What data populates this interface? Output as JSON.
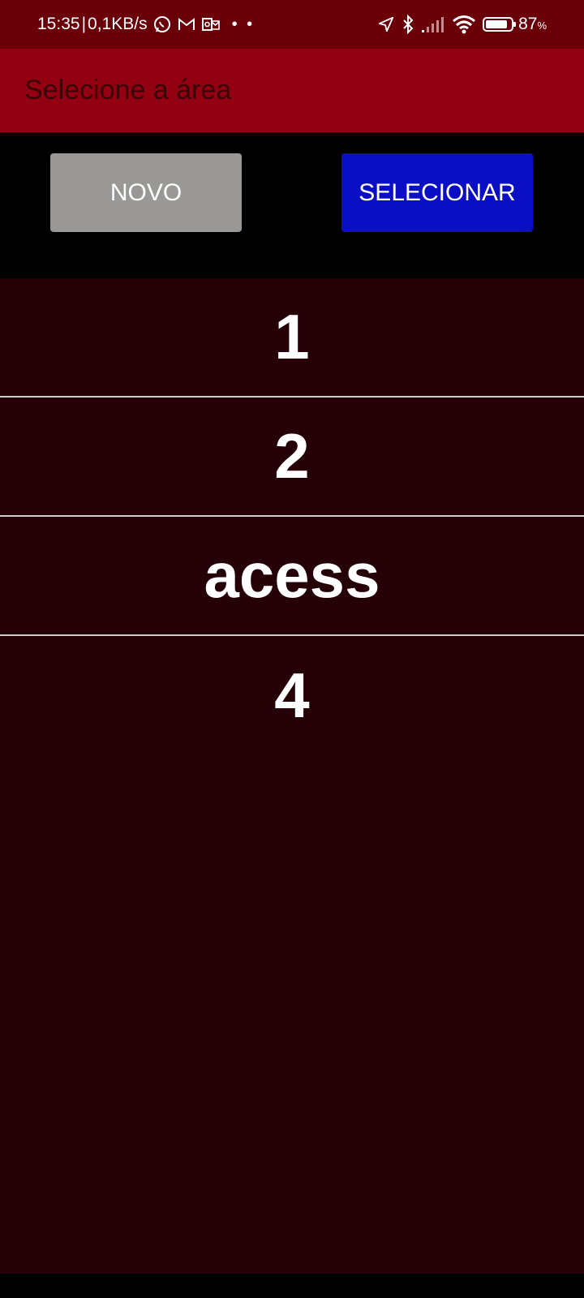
{
  "status_bar": {
    "time": "15:35",
    "separator": "|",
    "network_speed": "0,1KB/s",
    "left_icons": [
      "whatsapp-icon",
      "gmail-icon",
      "outlook-icon"
    ],
    "more_dots": "• •",
    "right_icons": [
      "location-arrow-icon",
      "bluetooth-icon",
      "cell-signal-icon",
      "wifi-icon",
      "battery-icon"
    ],
    "battery_percent": "87",
    "battery_unit": "%",
    "battery_level": 0.87
  },
  "app_bar": {
    "title": "Selecione a área"
  },
  "buttons": {
    "novo_label": "NOVO",
    "selecionar_label": "SELECIONAR"
  },
  "list": {
    "items": [
      {
        "label": "1"
      },
      {
        "label": "2"
      },
      {
        "label": "acess"
      },
      {
        "label": "4"
      }
    ]
  },
  "colors": {
    "status_bar_bg": "#6a0008",
    "app_bar_bg": "#930012",
    "app_title_text": "#3a0006",
    "novo_bg": "#9a9897",
    "selecionar_bg": "#0a0ec4",
    "list_bg": "#250006",
    "divider": "#cfcfcf"
  }
}
